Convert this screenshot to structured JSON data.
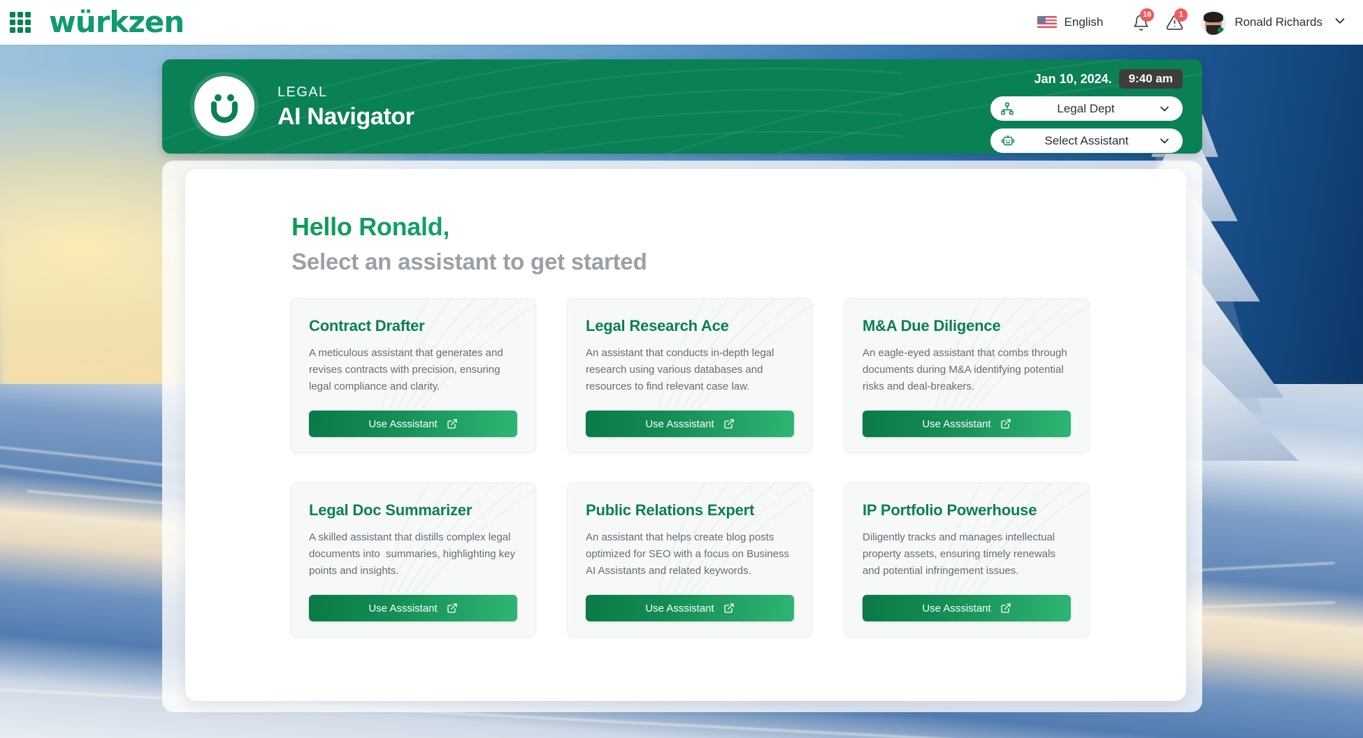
{
  "topbar": {
    "app_grid_icon": "apps-grid-icon",
    "brand": "würkzen",
    "language": {
      "label": "English",
      "flag": "us-flag-icon"
    },
    "notifications": {
      "icon": "bell-icon",
      "count": "16"
    },
    "alerts": {
      "icon": "warning-triangle-icon",
      "count": "1"
    },
    "user": {
      "name": "Ronald Richards",
      "avatar": "user-avatar",
      "caret": "chevron-down-icon"
    }
  },
  "banner": {
    "logo_icon": "wurkzen-smiley-logo",
    "eyebrow": "LEGAL",
    "title": "AI Navigator",
    "date": "Jan 10, 2024.",
    "time": "9:40 am",
    "department_select": {
      "icon": "org-chart-icon",
      "value": "Legal Dept",
      "caret": "chevron-down-icon"
    },
    "assistant_select": {
      "icon": "robot-icon",
      "value": "Select Assistant",
      "caret": "chevron-down-icon"
    }
  },
  "main": {
    "greeting": "Hello Ronald,",
    "subtitle": "Select an assistant to get started",
    "cards": [
      {
        "title": "Contract Drafter",
        "description": "A meticulous assistant that generates and revises contracts with precision, ensuring legal compliance and clarity.",
        "button": "Use Asssistant",
        "button_icon": "external-link-icon"
      },
      {
        "title": "Legal Research Ace",
        "description": "An assistant that conducts in-depth legal research using various databases and resources to find relevant case law.",
        "button": "Use Asssistant",
        "button_icon": "external-link-icon"
      },
      {
        "title": "M&A Due Diligence",
        "description": "An eagle-eyed assistant that combs through documents during M&A identifying potential risks and deal-breakers.",
        "button": "Use Asssistant",
        "button_icon": "external-link-icon"
      },
      {
        "title": "Legal Doc Summarizer",
        "description": "A skilled assistant that distills complex legal documents into  summaries, highlighting key points and insights.",
        "button": "Use Asssistant",
        "button_icon": "external-link-icon"
      },
      {
        "title": "Public Relations Expert",
        "description": "An assistant that helps create blog posts optimized for SEO with a focus on Business AI Assistants and related keywords.",
        "button": "Use Asssistant",
        "button_icon": "external-link-icon"
      },
      {
        "title": "IP Portfolio Powerhouse",
        "description": "Diligently tracks and manages intellectual property assets, ensuring timely renewals and potential infringement issues.",
        "button": "Use Asssistant",
        "button_icon": "external-link-icon"
      }
    ]
  },
  "colors": {
    "brand_green": "#0f9b6f",
    "banner_green": "#0a8055",
    "badge_red": "#ef5b5b",
    "time_pill": "#3d3d3d",
    "card_bg": "#f7f8f8",
    "subtitle_grey": "#9aa0a6"
  }
}
